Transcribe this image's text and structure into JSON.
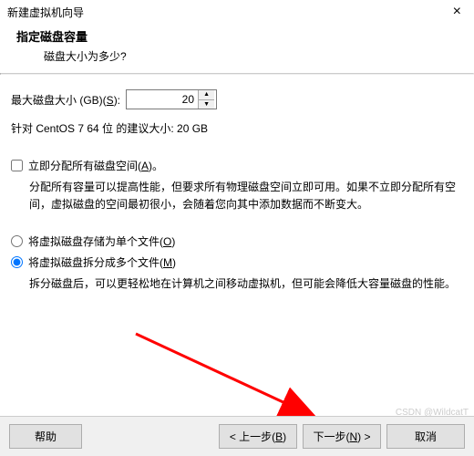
{
  "window": {
    "title": "新建虚拟机向导",
    "close": "×"
  },
  "header": {
    "title": "指定磁盘容量",
    "subtitle": "磁盘大小为多少?"
  },
  "disk": {
    "max_label_pre": "最大磁盘大小 (GB)(",
    "max_hotkey": "S",
    "max_label_post": "):",
    "value": "20",
    "recommendation": "针对 CentOS 7 64 位 的建议大小: 20 GB"
  },
  "allocate": {
    "label_pre": "立即分配所有磁盘空间(",
    "hotkey": "A",
    "label_post": ")。",
    "desc": "分配所有容量可以提高性能，但要求所有物理磁盘空间立即可用。如果不立即分配所有空间，虚拟磁盘的空间最初很小，会随着您向其中添加数据而不断变大。"
  },
  "store": {
    "single_pre": "将虚拟磁盘存储为单个文件(",
    "single_hotkey": "O",
    "single_post": ")",
    "split_pre": "将虚拟磁盘拆分成多个文件(",
    "split_hotkey": "M",
    "split_post": ")",
    "split_desc": "拆分磁盘后，可以更轻松地在计算机之间移动虚拟机，但可能会降低大容量磁盘的性能。"
  },
  "buttons": {
    "help": "帮助",
    "back_pre": "< 上一步(",
    "back_hotkey": "B",
    "back_post": ")",
    "next_pre": "下一步(",
    "next_hotkey": "N",
    "next_post": ") >",
    "cancel": "取消"
  },
  "watermark": "CSDN @WildcatT"
}
